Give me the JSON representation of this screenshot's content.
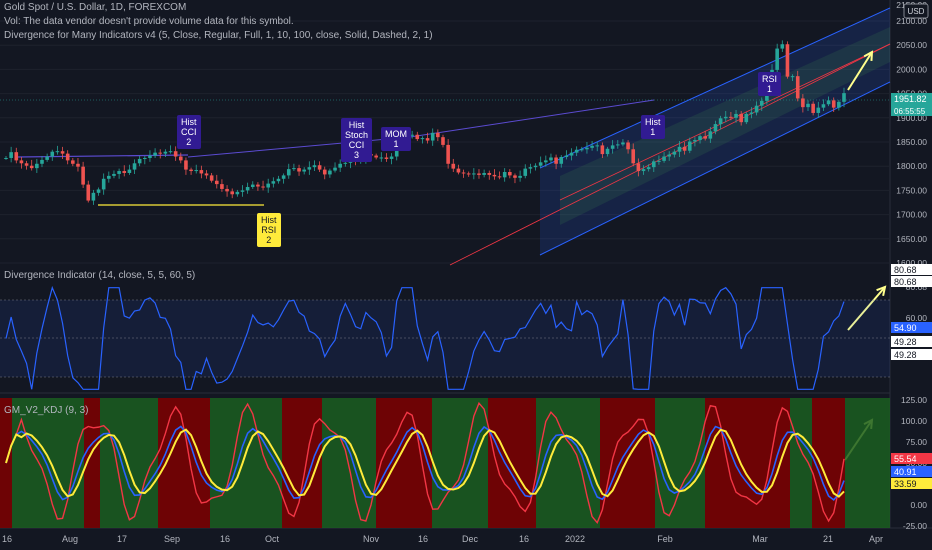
{
  "header": {
    "symbol_line": "Gold Spot / U.S. Dollar, 1D, FOREXCOM",
    "volume_note": "Vol: The data vendor doesn't provide volume data for this symbol.",
    "divergence_line": "Divergence for Many Indicators v4 (5, Close, Regular, Full, 1, 10, 100, close, Solid, Dashed, 2, 1)",
    "currency_badge": "USD"
  },
  "price_axis": {
    "ticks": [
      "2100.00",
      "2050.00",
      "2000.00",
      "1950.00",
      "1900.00",
      "1850.00",
      "1800.00",
      "1750.00",
      "1700.00",
      "1650.00",
      "1600.00"
    ],
    "last_price": "1951.82",
    "countdown": "06:55:55",
    "partial_top_label": "2150.00"
  },
  "divergence_labels": [
    {
      "lines": [
        "Hist",
        "CCI",
        "2"
      ],
      "style": "purple"
    },
    {
      "lines": [
        "Hist",
        "RSI",
        "2"
      ],
      "style": "yellow"
    },
    {
      "lines": [
        "Hist",
        "Stoch",
        "CCI",
        "3"
      ],
      "style": "purple"
    },
    {
      "lines": [
        "MOM",
        "1"
      ],
      "style": "purple"
    },
    {
      "lines": [
        "Hist",
        "1"
      ],
      "style": "purple"
    },
    {
      "lines": [
        "RSI",
        "1"
      ],
      "style": "purple"
    }
  ],
  "panel2": {
    "title": "Divergence Indicator (14, close, 5, 5, 60, 5)",
    "ticks": [
      "80.68",
      "60.00"
    ],
    "labels": [
      {
        "text": "80.68",
        "bg": "#ffffff",
        "fg": "#131722"
      },
      {
        "text": "80.68",
        "bg": "#ffffff",
        "fg": "#131722"
      },
      {
        "text": "54.90",
        "bg": "#2962ff",
        "fg": "#ffffff"
      },
      {
        "text": "49.28",
        "bg": "#ffffff",
        "fg": "#131722"
      },
      {
        "text": "49.28",
        "bg": "#ffffff",
        "fg": "#131722"
      }
    ]
  },
  "panel3": {
    "title": "GM_V2_KDJ (9, 3)",
    "ticks": [
      "125.00",
      "100.00",
      "75.00",
      "50.00",
      "25.00",
      "0.00",
      "-25.00"
    ],
    "labels": [
      {
        "text": "55.54",
        "bg": "#f23645",
        "fg": "#ffffff"
      },
      {
        "text": "40.91",
        "bg": "#2962ff",
        "fg": "#ffffff"
      },
      {
        "text": "33.59",
        "bg": "#ffeb3b",
        "fg": "#131722"
      }
    ]
  },
  "time_axis": {
    "labels": [
      "16",
      "Aug",
      "17",
      "Sep",
      "16",
      "Oct",
      "Nov",
      "16",
      "Dec",
      "16",
      "2022",
      "Feb",
      "Mar",
      "21",
      "Apr"
    ]
  },
  "colors": {
    "background": "#131722",
    "up_candle": "#26a69a",
    "down_candle": "#ef5350",
    "rsi_line": "#2962ff",
    "k_line": "#f23645",
    "d_line": "#2962ff",
    "j_line": "#ffeb3b",
    "bull_zone": "#1b5e20",
    "bear_zone": "#7f0000",
    "channel": "#2962ff",
    "annotation_arrow": "#ffff8d"
  },
  "chart_data": {
    "type": "candlestick",
    "symbol": "Gold Spot / U.S. Dollar",
    "interval": "1D",
    "x_range": [
      "2021-07-16",
      "2022-03-25"
    ],
    "ylim": [
      1600,
      2100
    ],
    "close_series": [
      1817,
      1829,
      1812,
      1806,
      1801,
      1796,
      1805,
      1813,
      1820,
      1830,
      1831,
      1826,
      1812,
      1805,
      1799,
      1762,
      1729,
      1745,
      1752,
      1774,
      1780,
      1784,
      1790,
      1786,
      1793,
      1806,
      1815,
      1817,
      1822,
      1828,
      1826,
      1830,
      1831,
      1820,
      1812,
      1793,
      1790,
      1792,
      1785,
      1781,
      1770,
      1763,
      1753,
      1748,
      1742,
      1747,
      1750,
      1757,
      1762,
      1758,
      1756,
      1764,
      1769,
      1774,
      1781,
      1794,
      1796,
      1789,
      1793,
      1798,
      1802,
      1793,
      1783,
      1791,
      1797,
      1805,
      1807,
      1811,
      1810,
      1815,
      1825,
      1822,
      1818,
      1818,
      1815,
      1820,
      1848,
      1859,
      1864,
      1865,
      1856,
      1858,
      1853,
      1869,
      1860,
      1844,
      1805,
      1795,
      1787,
      1785,
      1784,
      1785,
      1782,
      1786,
      1782,
      1779,
      1777,
      1788,
      1781,
      1776,
      1780,
      1795,
      1798,
      1801,
      1808,
      1812,
      1818,
      1805,
      1819,
      1822,
      1828,
      1834,
      1835,
      1838,
      1842,
      1843,
      1825,
      1836,
      1843,
      1845,
      1849,
      1835,
      1806,
      1790,
      1794,
      1798,
      1810,
      1811,
      1820,
      1824,
      1830,
      1840,
      1832,
      1851,
      1854,
      1862,
      1857,
      1872,
      1887,
      1899,
      1902,
      1900,
      1908,
      1891,
      1908,
      1911,
      1925,
      1935,
      1970,
      1999,
      2043,
      2052,
      1985,
      1986,
      1940,
      1922,
      1929,
      1910,
      1921,
      1928,
      1936,
      1921,
      1933,
      1951
    ],
    "divergence_indicator": {
      "name": "Divergence Indicator (14, close, 5, 5, 60, 5)",
      "last_values": [
        80.68,
        54.9,
        49.28
      ],
      "levels": [
        70,
        30
      ]
    },
    "kdj": {
      "name": "GM_V2_KDJ (9, 3)",
      "K": 40.91,
      "D": 33.59,
      "J": 55.54,
      "ylim": [
        -25,
        125
      ]
    }
  }
}
